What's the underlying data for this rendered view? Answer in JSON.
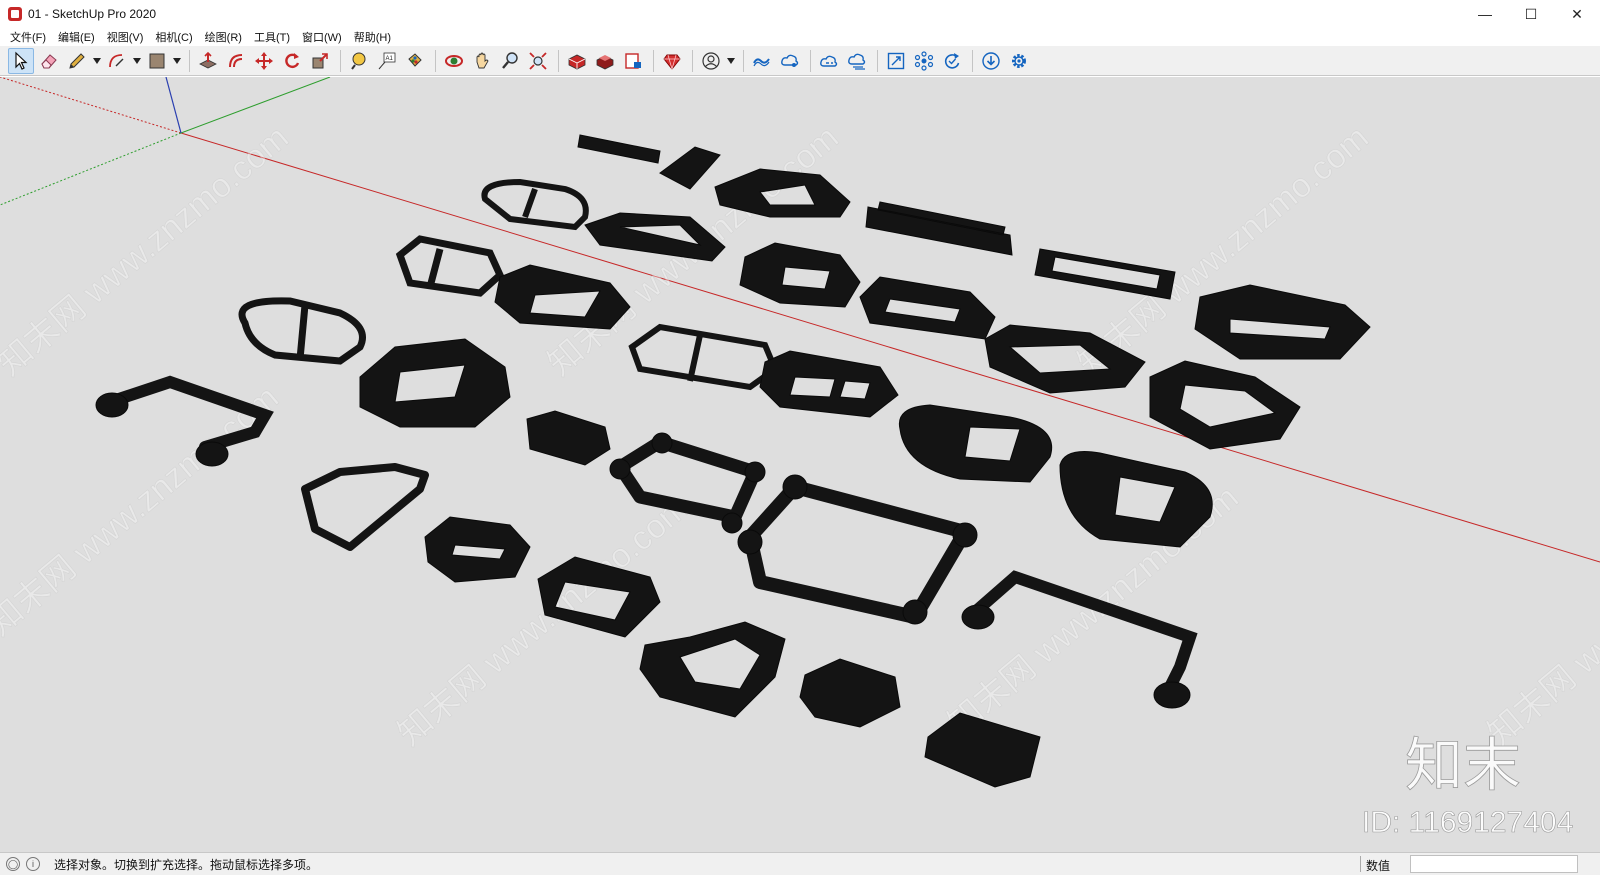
{
  "window": {
    "title": "01 - SketchUp Pro 2020",
    "minimize": "—",
    "maximize": "☐",
    "close": "✕"
  },
  "menu": [
    "文件(F)",
    "编辑(E)",
    "视图(V)",
    "相机(C)",
    "绘图(R)",
    "工具(T)",
    "窗口(W)",
    "帮助(H)"
  ],
  "toolbar": {
    "icons": [
      "select-icon",
      "eraser-icon",
      "pencil-line-icon",
      "arc-icon",
      "rectangle-icon",
      "push-pull-icon",
      "offset-icon",
      "move-icon",
      "rotate-icon",
      "scale-icon",
      "tape-measure-icon",
      "text-icon",
      "paint-bucket-icon",
      "orbit-icon",
      "pan-icon",
      "zoom-icon",
      "zoom-extents-icon",
      "warehouse-icon",
      "extension-warehouse-icon",
      "layout-icon",
      "ruby-icon",
      "account-icon",
      "trimble-connect-icon",
      "trimble-share-icon",
      "cloud-upload-icon",
      "cloud-sync-icon",
      "fit-icon",
      "components-icon",
      "refresh-icon",
      "download-icon",
      "settings-icon"
    ]
  },
  "viewport": {
    "background": "#dedede",
    "object_color": "#141414",
    "axis_red": "#c62828",
    "axis_green": "#2e9e2e",
    "axis_blue": "#2a3fb0",
    "watermark_text": "www.znzmo.com",
    "watermark_cn": "知末网",
    "logo_text": "知末",
    "id_text": "ID: 1169127404"
  },
  "statusbar": {
    "hint": "选择对象。切换到扩充选择。拖动鼠标选择多项。",
    "measure_label": "数值",
    "measure_value": ""
  }
}
